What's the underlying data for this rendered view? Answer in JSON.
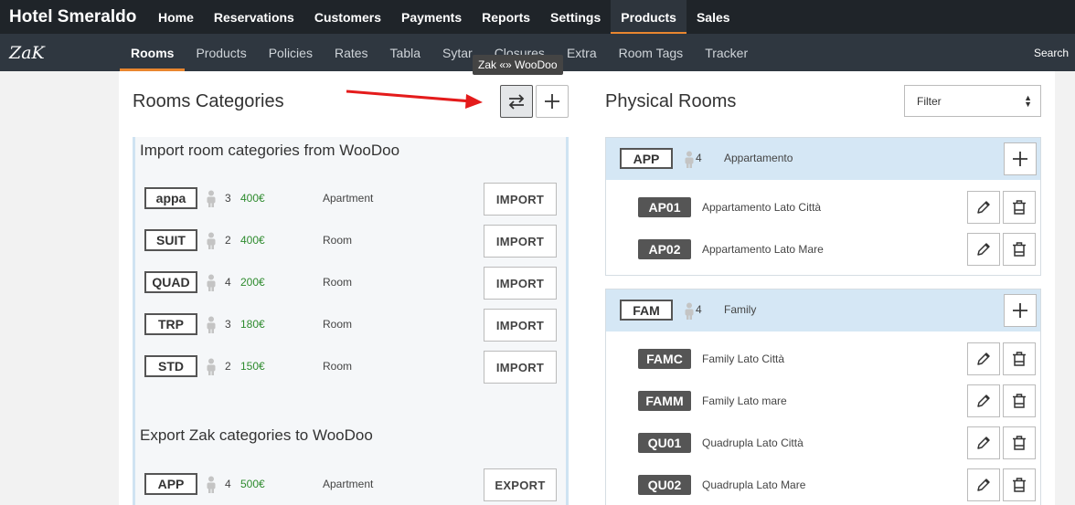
{
  "app": {
    "title": "Hotel Smeraldo",
    "logo": "ZaK"
  },
  "topnav": {
    "items": [
      {
        "label": "Home"
      },
      {
        "label": "Reservations"
      },
      {
        "label": "Customers"
      },
      {
        "label": "Payments"
      },
      {
        "label": "Reports"
      },
      {
        "label": "Settings"
      },
      {
        "label": "Products",
        "active": true
      },
      {
        "label": "Sales"
      }
    ]
  },
  "subnav": {
    "items": [
      {
        "label": "Rooms",
        "active": true
      },
      {
        "label": "Products"
      },
      {
        "label": "Policies"
      },
      {
        "label": "Rates"
      },
      {
        "label": "Tabla"
      },
      {
        "label": "Sytar"
      },
      {
        "label": "Closures"
      },
      {
        "label": "Extra"
      },
      {
        "label": "Room Tags"
      },
      {
        "label": "Tracker"
      }
    ],
    "search_label": "Search"
  },
  "tooltip": "Zak «» WooDoo",
  "left": {
    "title": "Rooms Categories",
    "import_heading": "Import room categories from WooDoo",
    "export_heading": "Export Zak categories to WooDoo",
    "import_rows": [
      {
        "code": "appa",
        "capacity": "3",
        "price": "400€",
        "name": "Apartment",
        "action": "IMPORT"
      },
      {
        "code": "SUIT",
        "capacity": "2",
        "price": "400€",
        "name": "Room",
        "action": "IMPORT"
      },
      {
        "code": "QUAD",
        "capacity": "4",
        "price": "200€",
        "name": "Room",
        "action": "IMPORT"
      },
      {
        "code": "TRP",
        "capacity": "3",
        "price": "180€",
        "name": "Room",
        "action": "IMPORT"
      },
      {
        "code": "STD",
        "capacity": "2",
        "price": "150€",
        "name": "Room",
        "action": "IMPORT"
      }
    ],
    "export_rows": [
      {
        "code": "APP",
        "capacity": "4",
        "price": "500€",
        "name": "Apartment",
        "action": "EXPORT"
      }
    ]
  },
  "right": {
    "title": "Physical Rooms",
    "filter": {
      "selected": "Filter"
    },
    "groups": [
      {
        "code": "APP",
        "capacity": "4",
        "name": "Appartamento",
        "rooms": [
          {
            "code": "AP01",
            "name": "Appartamento Lato Città"
          },
          {
            "code": "AP02",
            "name": "Appartamento Lato Mare"
          }
        ]
      },
      {
        "code": "FAM",
        "capacity": "4",
        "name": "Family",
        "rooms": [
          {
            "code": "FAMC",
            "name": "Family Lato Città"
          },
          {
            "code": "FAMM",
            "name": "Family Lato mare"
          },
          {
            "code": "QU01",
            "name": "Quadrupla Lato Città"
          },
          {
            "code": "QU02",
            "name": "Quadrupla Lato Mare"
          }
        ]
      }
    ]
  },
  "colors": {
    "accent": "#e9862f",
    "price": "#2e8b2e",
    "group_header": "#d5e7f5",
    "arrow": "#e41b1b"
  },
  "icons": {
    "sync": "swap-arrows-icon",
    "add": "plus-icon",
    "edit": "pencil-icon",
    "delete": "trash-icon",
    "capacity": "person-icon"
  }
}
